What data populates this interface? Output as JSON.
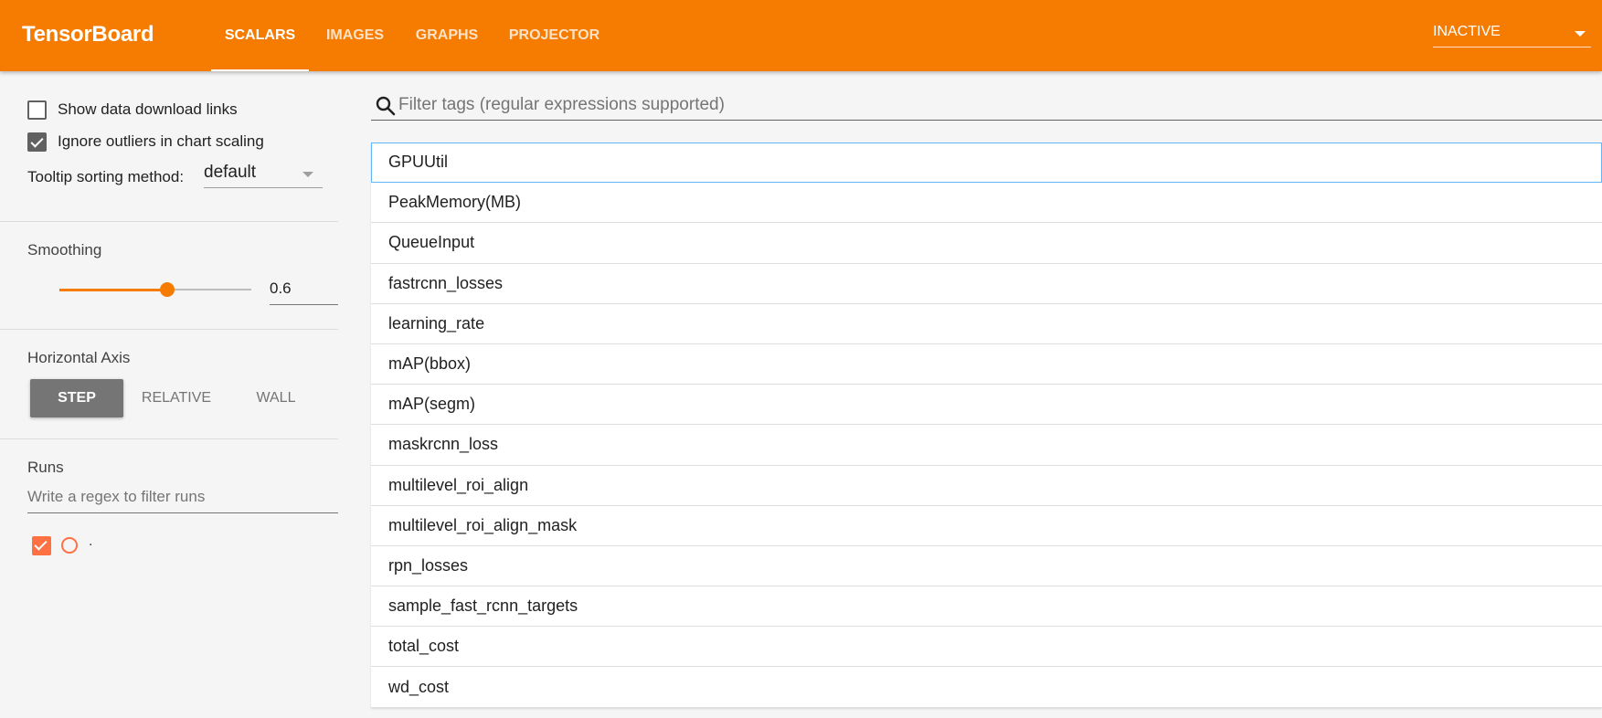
{
  "app": {
    "title": "TensorBoard"
  },
  "tabs": [
    {
      "label": "SCALARS",
      "active": true
    },
    {
      "label": "IMAGES",
      "active": false
    },
    {
      "label": "GRAPHS",
      "active": false
    },
    {
      "label": "PROJECTOR",
      "active": false
    }
  ],
  "run_selector": {
    "value": "INACTIVE"
  },
  "sidebar": {
    "show_download_links": {
      "label": "Show data download links",
      "checked": false
    },
    "ignore_outliers": {
      "label": "Ignore outliers in chart scaling",
      "checked": true
    },
    "tooltip_sort": {
      "label": "Tooltip sorting method:",
      "value": "default"
    },
    "smoothing": {
      "title": "Smoothing",
      "value": "0.6",
      "fraction": 0.6
    },
    "horizontal_axis": {
      "title": "Horizontal Axis",
      "options": [
        {
          "label": "STEP",
          "active": true
        },
        {
          "label": "RELATIVE",
          "active": false
        },
        {
          "label": "WALL",
          "active": false
        }
      ]
    },
    "runs": {
      "title": "Runs",
      "filter_placeholder": "Write a regex to filter runs",
      "items": [
        {
          "name": ".",
          "checked": true
        }
      ]
    }
  },
  "main": {
    "search_placeholder": "Filter tags (regular expressions supported)",
    "tags": [
      "GPUUtil",
      "PeakMemory(MB)",
      "QueueInput",
      "fastrcnn_losses",
      "learning_rate",
      "mAP(bbox)",
      "mAP(segm)",
      "maskrcnn_loss",
      "multilevel_roi_align",
      "multilevel_roi_align_mask",
      "rpn_losses",
      "sample_fast_rcnn_targets",
      "total_cost",
      "wd_cost"
    ]
  },
  "colors": {
    "brand": "#f57c00",
    "run": "#ff7043",
    "axis_active": "#757575"
  },
  "icons": {
    "search": "search-icon",
    "caret": "chevron-down-icon"
  }
}
